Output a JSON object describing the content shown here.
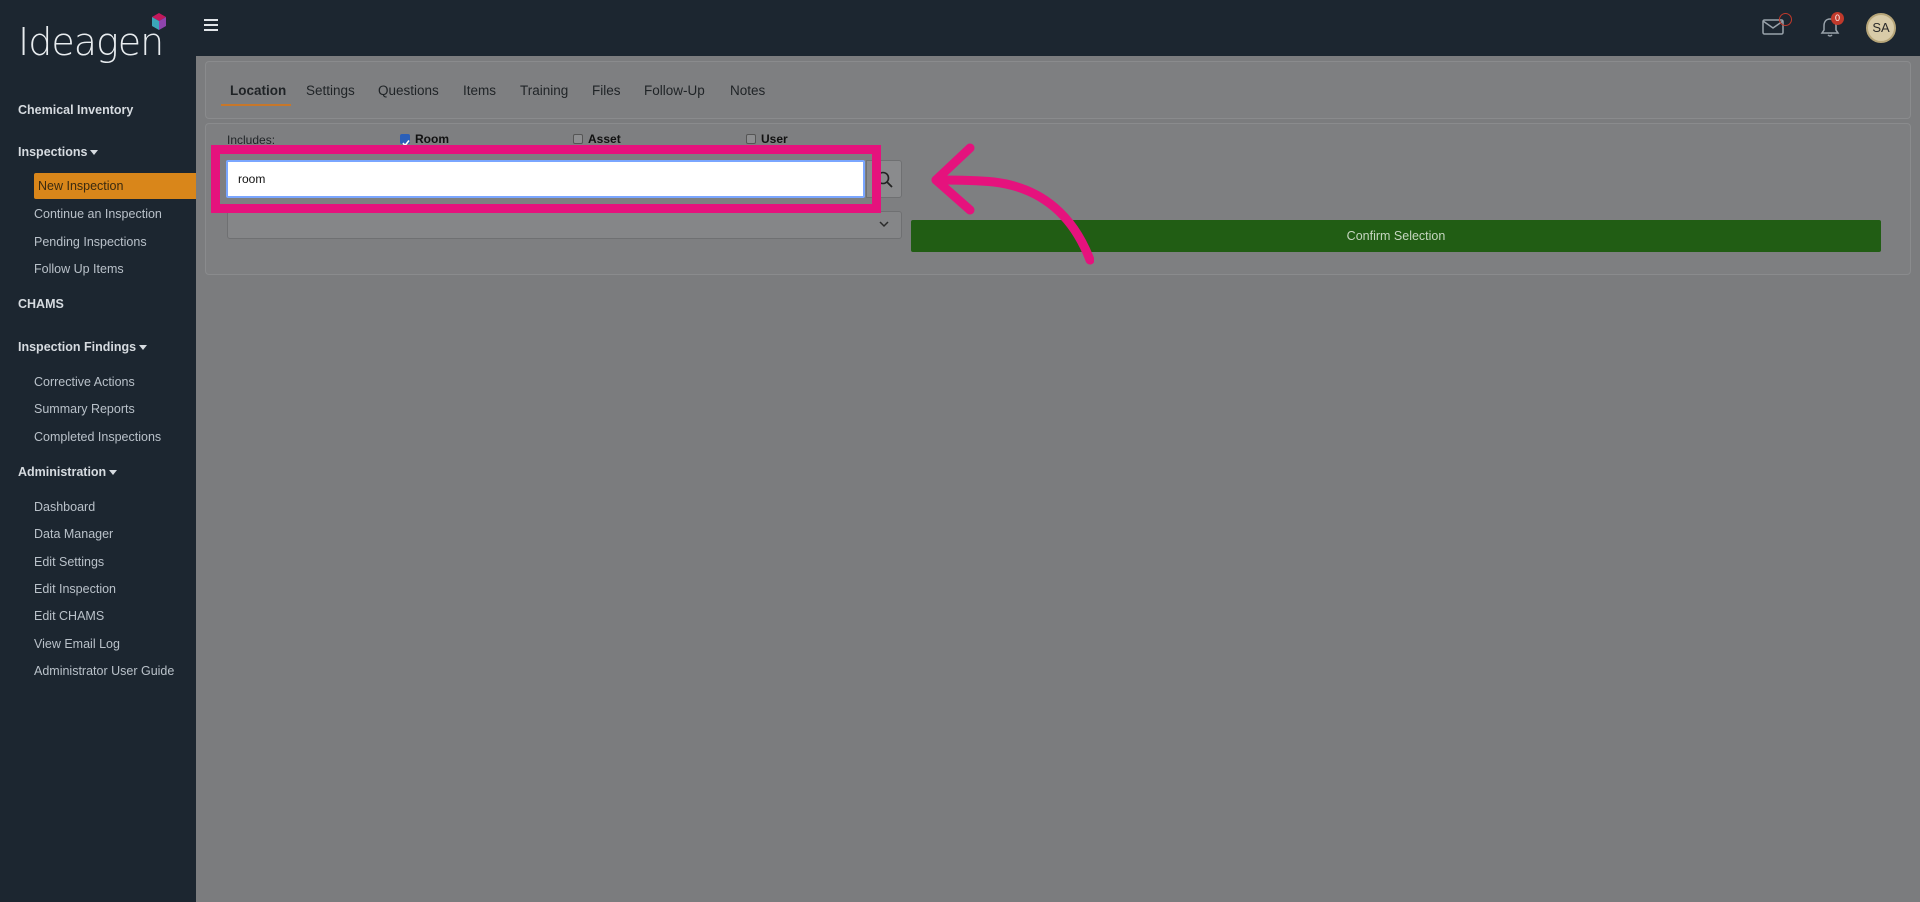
{
  "app": {
    "logo_text": "Ideagen",
    "avatar_initials": "SA",
    "notification_count": "0"
  },
  "sidebar": {
    "chemical_inventory": "Chemical Inventory",
    "inspections": "Inspections",
    "new_inspection": "New Inspection",
    "continue_inspection": "Continue an Inspection",
    "pending_inspections": "Pending Inspections",
    "follow_up_items": "Follow Up Items",
    "chams": "CHAMS",
    "inspection_findings": "Inspection Findings",
    "corrective_actions": "Corrective Actions",
    "summary_reports": "Summary Reports",
    "completed_inspections": "Completed Inspections",
    "administration": "Administration",
    "dashboard": "Dashboard",
    "data_manager": "Data Manager",
    "edit_settings": "Edit Settings",
    "edit_inspection": "Edit Inspection",
    "edit_chams": "Edit CHAMS",
    "view_email_log": "View Email Log",
    "admin_user_guide": "Administrator User Guide"
  },
  "tabs": {
    "location": "Location",
    "settings": "Settings",
    "questions": "Questions",
    "items": "Items",
    "training": "Training",
    "files": "Files",
    "follow_up": "Follow-Up",
    "notes": "Notes"
  },
  "location": {
    "includes_label": "Includes:",
    "room_label": "Room",
    "asset_label": "Asset",
    "user_label": "User",
    "room_checked": true,
    "asset_checked": false,
    "user_checked": false,
    "search_value": "room",
    "confirm_label": "Confirm Selection"
  },
  "colors": {
    "sidebar_bg": "#1c2630",
    "active_nav": "#d9861a",
    "highlight": "#e5127d",
    "confirm_btn": "#215d14"
  }
}
